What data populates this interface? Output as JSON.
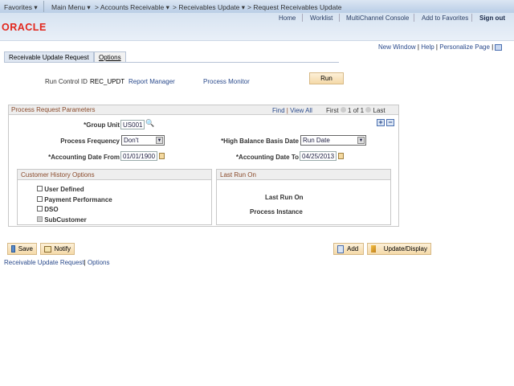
{
  "topbar": {
    "favorites": "Favorites",
    "main_menu": "Main Menu",
    "crumbs": [
      "Accounts Receivable",
      "Receivables Update",
      "Request Receivables Update"
    ]
  },
  "header": {
    "links": [
      "Home",
      "Worklist",
      "MultiChannel Console",
      "Add to Favorites",
      "Sign out"
    ],
    "logo": "ORACLE"
  },
  "utility": {
    "new_window": "New Window",
    "help": "Help",
    "personalize": "Personalize Page"
  },
  "tabs": [
    {
      "label": "Receivable Update Request",
      "active": true
    },
    {
      "label": "Options",
      "active": false
    }
  ],
  "run": {
    "run_control_label": "Run Control ID",
    "run_control_value": "REC_UPDT",
    "report_manager": "Report Manager",
    "process_monitor": "Process Monitor",
    "run_button": "Run"
  },
  "params": {
    "title": "Process Request Parameters",
    "find": "Find",
    "view_all": "View All",
    "first": "First",
    "count": "1 of 1",
    "last": "Last",
    "group_unit_label": "*Group Unit",
    "group_unit_value": "US001",
    "freq_label": "Process Frequency",
    "freq_value": "Don't",
    "hb_label": "*High Balance Basis Date",
    "hb_value": "Run Date",
    "from_label": "*Accounting Date From",
    "from_value": "01/01/1900",
    "to_label": "*Accounting Date To",
    "to_value": "04/25/2013"
  },
  "history": {
    "title": "Customer History Options",
    "options": [
      {
        "label": "User Defined",
        "checked": false
      },
      {
        "label": "Payment Performance",
        "checked": false
      },
      {
        "label": "DSO",
        "checked": false
      },
      {
        "label": "SubCustomer",
        "checked": false,
        "disabled": true
      }
    ]
  },
  "last_run": {
    "title": "Last Run On",
    "last_run_label": "Last Run On",
    "instance_label": "Process Instance"
  },
  "buttons": {
    "save": "Save",
    "notify": "Notify",
    "add": "Add",
    "update": "Update/Display"
  },
  "footer_links": {
    "request": "Receivable Update Request",
    "options": "Options"
  }
}
